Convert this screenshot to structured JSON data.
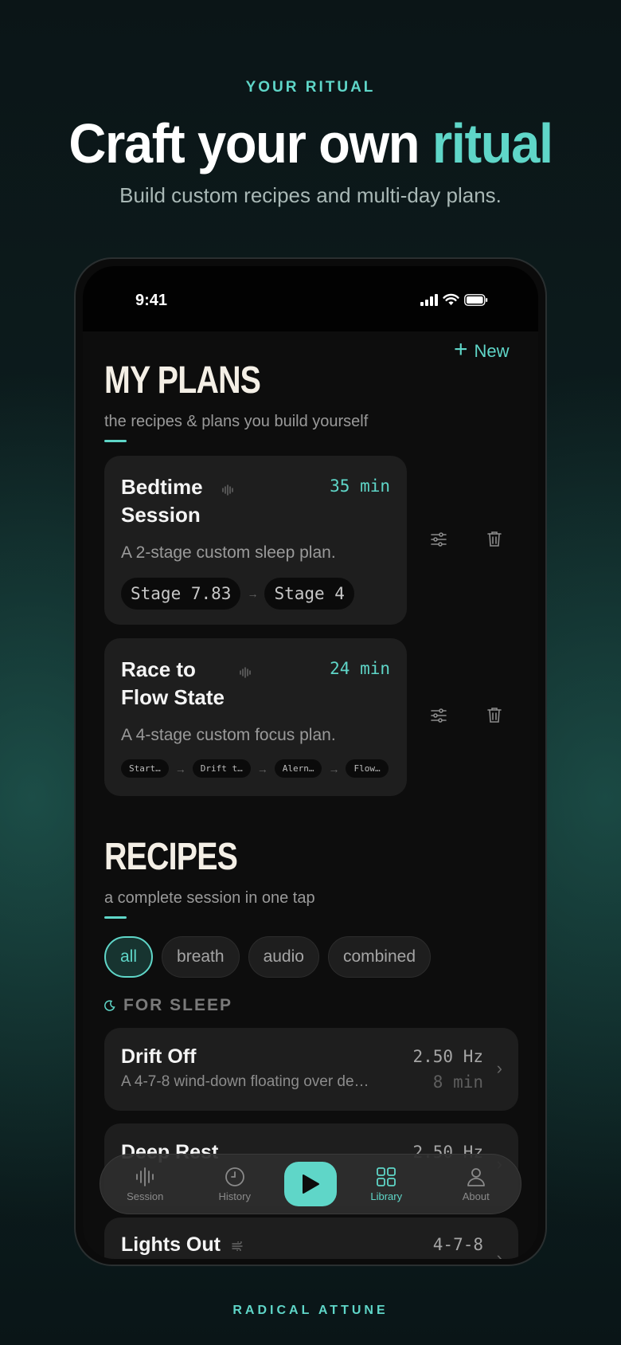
{
  "header": {
    "eyebrow": "YOUR RITUAL",
    "headline_main": "Craft your own ",
    "headline_accent": "ritual",
    "subhead": "Build custom recipes and multi-day plans."
  },
  "status_bar": {
    "time": "9:41"
  },
  "new_button": {
    "label": "New"
  },
  "plans_section": {
    "title": "MY PLANS",
    "subtitle": "the recipes & plans you build yourself",
    "plans": [
      {
        "name": "Bedtime Session",
        "duration": "35 min",
        "description": "A 2-stage custom sleep plan.",
        "stages": [
          "Stage 7.83",
          "Stage 4"
        ]
      },
      {
        "name": "Race to Flow State",
        "duration": "24 min",
        "description": "A 4-stage custom focus plan.",
        "stages": [
          "Start…",
          "Drift t…",
          "Alern…",
          "Flow…"
        ]
      }
    ]
  },
  "recipes_section": {
    "title": "RECIPES",
    "subtitle": "a complete session in one tap",
    "filters": [
      "all",
      "breath",
      "audio",
      "combined"
    ],
    "active_filter": "all",
    "group_heading": "FOR SLEEP",
    "recipes": [
      {
        "name": "Drift Off",
        "description": "A 4-7-8 wind-down floating over de…",
        "freq": "2.50 Hz",
        "length": "8 min"
      },
      {
        "name": "Deep Rest",
        "freq": "2.50 Hz"
      },
      {
        "name": "Lights Out",
        "freq": "4-7-8"
      }
    ]
  },
  "tab_bar": {
    "tabs": [
      {
        "label": "Session",
        "icon": "waveform-icon"
      },
      {
        "label": "History",
        "icon": "clock-icon"
      },
      {
        "label": "Library",
        "icon": "grid-icon"
      },
      {
        "label": "About",
        "icon": "person-icon"
      }
    ],
    "active": "Library"
  },
  "footer": {
    "brand": "RADICAL ATTUNE"
  },
  "colors": {
    "accent": "#5fd6c8",
    "card": "#1e1e1e",
    "screen": "#0d0d0d"
  }
}
